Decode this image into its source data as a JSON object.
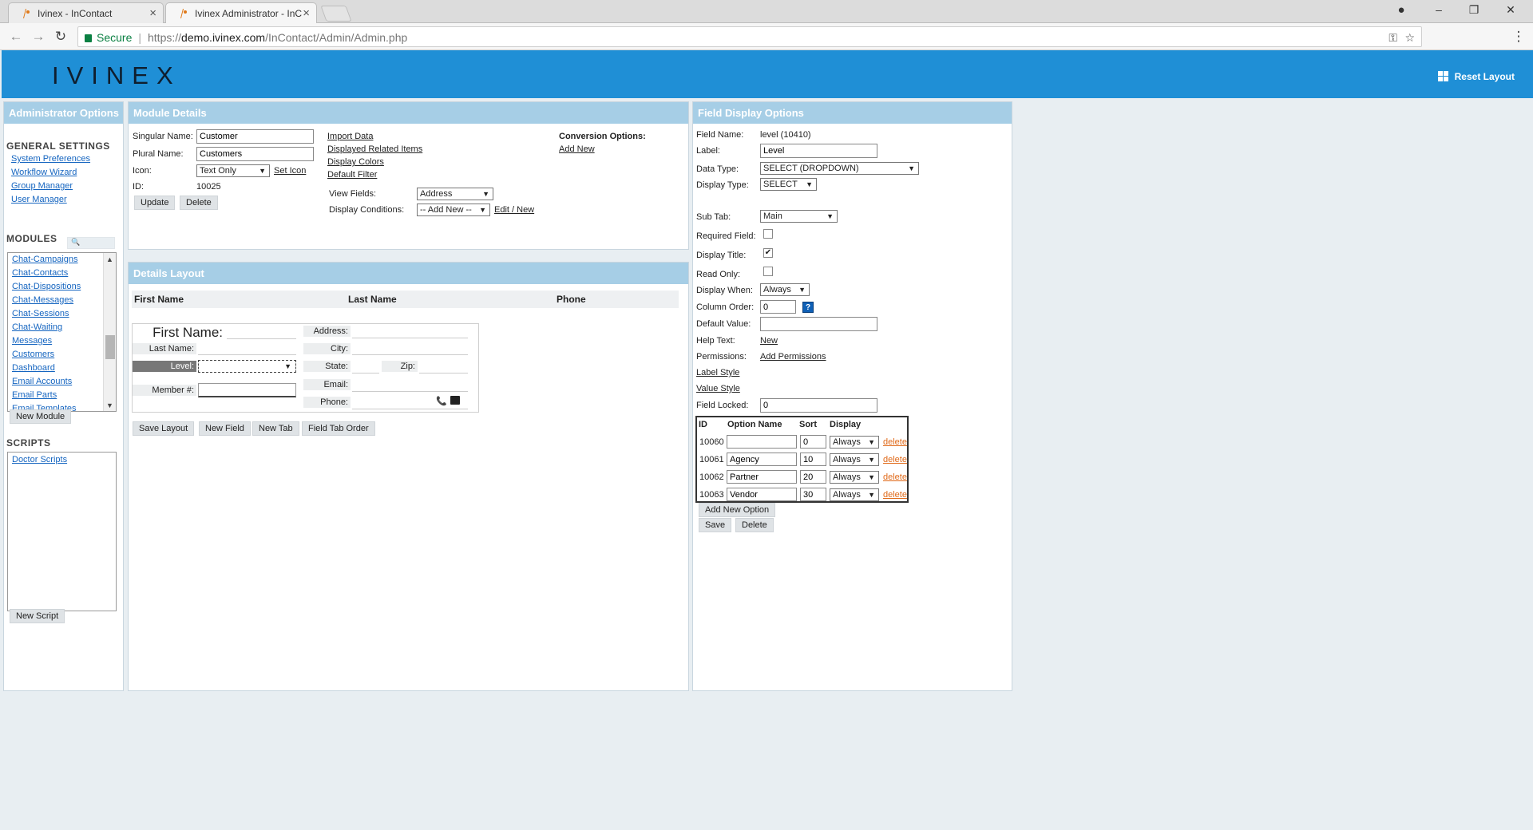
{
  "browser": {
    "tabs": [
      {
        "title": "Ivinex - InContact"
      },
      {
        "title": "Ivinex Administrator - InC"
      }
    ],
    "secure_label": "Secure",
    "url_scheme": "https://",
    "url_host": "demo.ivinex.com",
    "url_path": "/InContact/Admin/Admin.php"
  },
  "header": {
    "logo": "IVINEX",
    "reset_layout": "Reset Layout",
    "accent_color": "#1f8fd6"
  },
  "left_panel": {
    "title": "Administrator Options",
    "general_settings_title": "GENERAL SETTINGS",
    "general_links": [
      "System Preferences",
      "Workflow Wizard",
      "Group Manager",
      "User Manager"
    ],
    "modules_title": "MODULES",
    "modules": [
      "Chat-Campaigns",
      "Chat-Contacts",
      "Chat-Dispositions",
      "Chat-Messages",
      "Chat-Sessions",
      "Chat-Waiting",
      "Messages",
      "Customers",
      "Dashboard",
      "Email Accounts",
      "Email Parts",
      "Email Templates"
    ],
    "new_module": "New Module",
    "scripts_title": "SCRIPTS",
    "scripts": [
      "Doctor Scripts"
    ],
    "new_script": "New Script"
  },
  "module_details": {
    "title": "Module Details",
    "singular_label": "Singular Name:",
    "singular_value": "Customer",
    "plural_label": "Plural Name:",
    "plural_value": "Customers",
    "icon_label": "Icon:",
    "icon_value": "Text Only",
    "set_icon": "Set Icon",
    "id_label": "ID:",
    "id_value": "10025",
    "update": "Update",
    "delete": "Delete",
    "links": [
      "Import Data",
      "Displayed Related Items",
      "Display Colors",
      "Default Filter"
    ],
    "view_fields_label": "View Fields:",
    "view_fields_value": "Address",
    "display_conditions_label": "Display Conditions:",
    "display_conditions_value": "-- Add New --",
    "edit_new": "Edit / New",
    "conversion_title": "Conversion Options:",
    "conversion_add": "Add New"
  },
  "details_layout": {
    "title": "Details Layout",
    "columns": [
      "First Name",
      "Last Name",
      "Phone"
    ],
    "form": {
      "first_name": "First Name:",
      "last_name": "Last Name:",
      "level": "Level:",
      "member": "Member #:",
      "address": "Address:",
      "city": "City:",
      "state": "State:",
      "zip": "Zip:",
      "email": "Email:",
      "phone": "Phone:"
    },
    "buttons": [
      "Save Layout",
      "New Field",
      "New Tab",
      "Field Tab Order"
    ]
  },
  "field_options": {
    "title": "Field Display Options",
    "field_name_label": "Field Name:",
    "field_name_value": "level (10410)",
    "label_label": "Label:",
    "label_value": "Level",
    "data_type_label": "Data Type:",
    "data_type_value": "SELECT (DROPDOWN)",
    "display_type_label": "Display Type:",
    "display_type_value": "SELECT",
    "sub_tab_label": "Sub Tab:",
    "sub_tab_value": "Main",
    "required_label": "Required Field:",
    "required_checked": false,
    "display_title_label": "Display Title:",
    "display_title_checked": true,
    "read_only_label": "Read Only:",
    "read_only_checked": false,
    "display_when_label": "Display When:",
    "display_when_value": "Always",
    "column_order_label": "Column Order:",
    "column_order_value": "0",
    "help_q": "?",
    "default_value_label": "Default Value:",
    "default_value_value": "",
    "help_text_label": "Help Text:",
    "help_text_link": "New",
    "permissions_label": "Permissions:",
    "permissions_link": "Add Permissions",
    "label_style": "Label Style",
    "value_style": "Value Style",
    "field_locked_label": "Field Locked:",
    "field_locked_value": "0",
    "table_headers": [
      "ID",
      "Option Name",
      "Sort",
      "Display"
    ],
    "options": [
      {
        "id": "10060",
        "name": "",
        "sort": "0",
        "display": "Always"
      },
      {
        "id": "10061",
        "name": "Agency",
        "sort": "10",
        "display": "Always"
      },
      {
        "id": "10062",
        "name": "Partner",
        "sort": "20",
        "display": "Always"
      },
      {
        "id": "10063",
        "name": "Vendor",
        "sort": "30",
        "display": "Always"
      }
    ],
    "delete_label": "delete",
    "add_new_option": "Add New Option",
    "save": "Save",
    "delete": "Delete"
  }
}
